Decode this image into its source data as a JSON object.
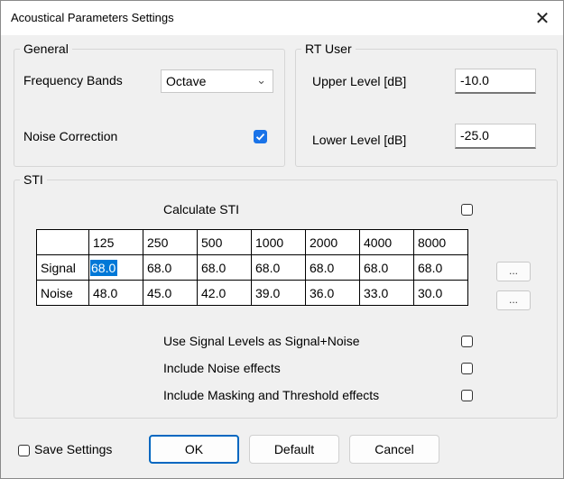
{
  "window": {
    "title": "Acoustical Parameters Settings",
    "close_glyph": "✕"
  },
  "general": {
    "legend": "General",
    "frequency_bands_label": "Frequency Bands",
    "frequency_bands_value": "Octave",
    "noise_correction_label": "Noise Correction",
    "noise_correction_checked": true
  },
  "rt_user": {
    "legend": "RT User",
    "upper_level_label": "Upper Level [dB]",
    "upper_level_value": "-10.0",
    "lower_level_label": "Lower Level [dB]",
    "lower_level_value": "-25.0"
  },
  "sti": {
    "legend": "STI",
    "calculate_label": "Calculate STI",
    "calculate_checked": false,
    "table": {
      "columns": [
        "125",
        "250",
        "500",
        "1000",
        "2000",
        "4000",
        "8000"
      ],
      "rows": [
        {
          "label": "Signal",
          "values": [
            "68.0",
            "68.0",
            "68.0",
            "68.0",
            "68.0",
            "68.0",
            "68.0"
          ]
        },
        {
          "label": "Noise",
          "values": [
            "48.0",
            "45.0",
            "42.0",
            "39.0",
            "36.0",
            "33.0",
            "30.0"
          ]
        }
      ]
    },
    "dots_label": "...",
    "options": [
      {
        "label": "Use Signal Levels as Signal+Noise",
        "checked": false
      },
      {
        "label": "Include Noise effects",
        "checked": false
      },
      {
        "label": "Include Masking and Threshold effects",
        "checked": false
      }
    ]
  },
  "footer": {
    "save_settings_label": "Save Settings",
    "save_settings_checked": false,
    "ok_label": "OK",
    "default_label": "Default",
    "cancel_label": "Cancel"
  },
  "colors": {
    "accent": "#0078d7",
    "checkbox_checked": "#1a73e8",
    "dialog_bg": "#f0f0f0"
  }
}
